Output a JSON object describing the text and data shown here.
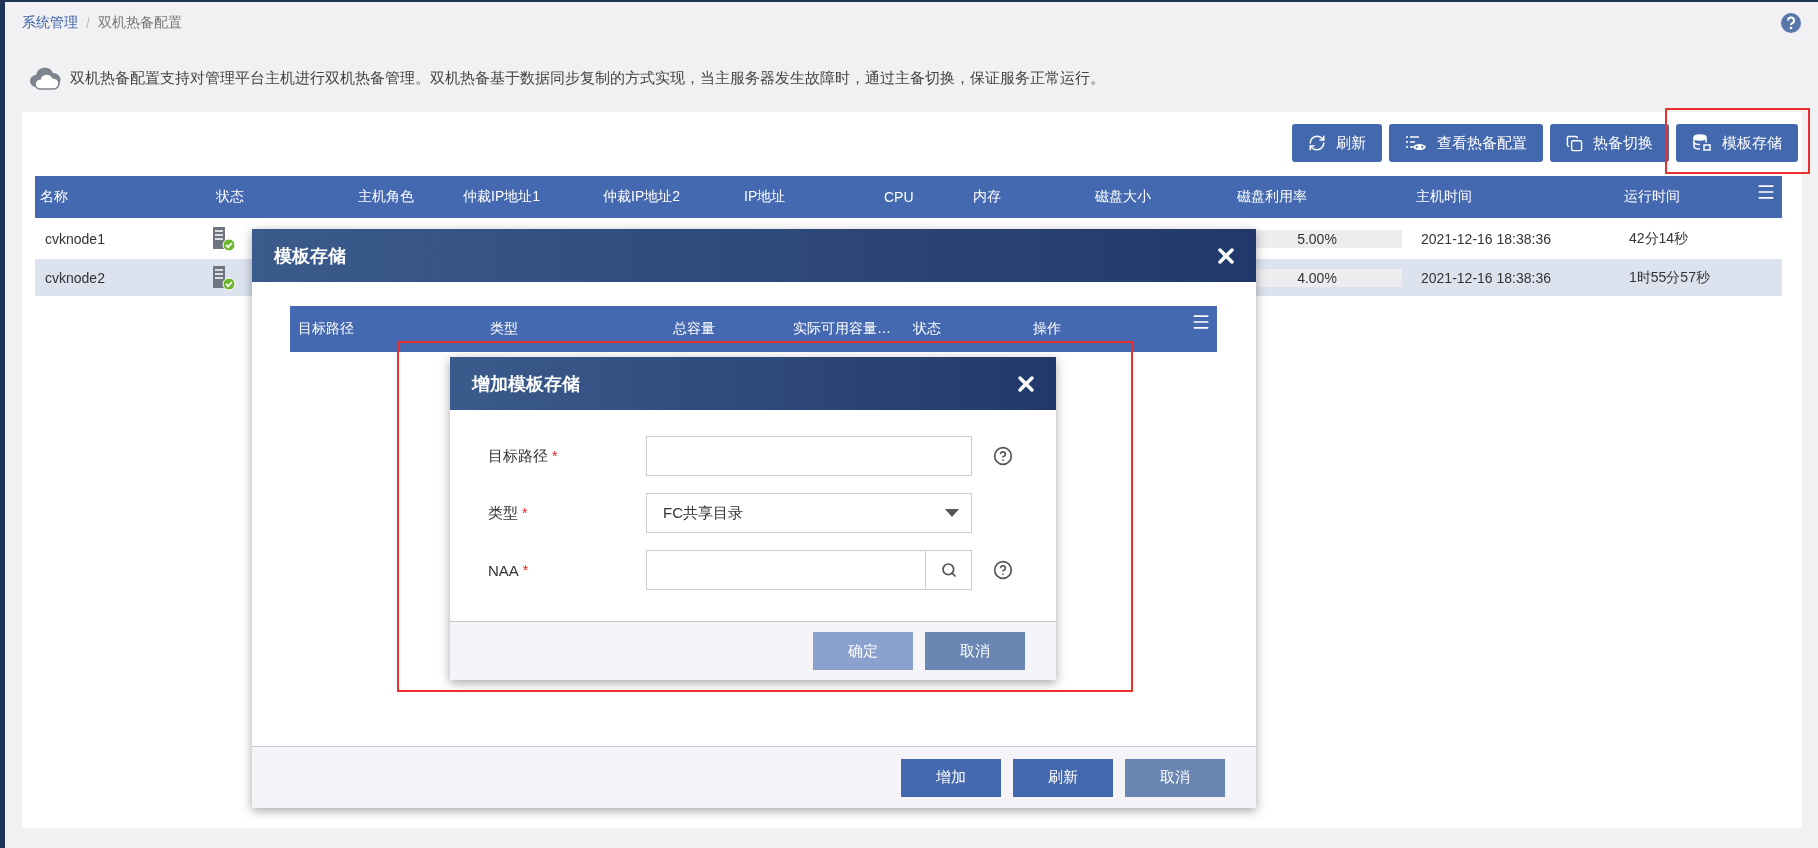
{
  "breadcrumb": {
    "parent": "系统管理",
    "separator": "/",
    "current": "双机热备配置"
  },
  "info_text": "双机热备配置支持对管理平台主机进行双机热备管理。双机热备基于数据同步复制的方式实现，当主服务器发生故障时，通过主备切换，保证服务正常运行。",
  "toolbar": [
    {
      "label": "刷新",
      "kind": "refresh"
    },
    {
      "label": "查看热备配置",
      "kind": "view"
    },
    {
      "label": "热备切换",
      "kind": "switch"
    },
    {
      "label": "模板存储",
      "kind": "storage"
    }
  ],
  "table": {
    "columns": [
      "名称",
      "状态",
      "主机角色",
      "仲裁IP地址1",
      "仲裁IP地址2",
      "IP地址",
      "CPU",
      "内存",
      "磁盘大小",
      "磁盘利用率",
      "主机时间",
      "运行时间"
    ],
    "rows": [
      {
        "name": "cvknode1",
        "selected": false,
        "disk_usage": "5.00%",
        "host_time": "2021-12-16 18:38:36",
        "run_time": "42分14秒"
      },
      {
        "name": "cvknode2",
        "selected": true,
        "disk_usage": "4.00%",
        "host_time": "2021-12-16 18:38:36",
        "run_time": "1时55分57秒"
      }
    ]
  },
  "dialog": {
    "title": "模板存储",
    "columns": [
      "目标路径",
      "类型",
      "总容量",
      "实际可用容量…",
      "状态",
      "操作"
    ],
    "buttons": [
      {
        "label": "增加",
        "kind": "primary",
        "disabled": false
      },
      {
        "label": "刷新",
        "kind": "primary",
        "disabled": false
      },
      {
        "label": "取消",
        "kind": "cancel",
        "disabled": false
      }
    ]
  },
  "subdialog": {
    "title": "增加模板存储",
    "fields": [
      {
        "label": "目标路径",
        "required_mark": "*",
        "kind": "text",
        "help": true
      },
      {
        "label": "类型",
        "required_mark": "*",
        "kind": "select",
        "value": "FC共享目录"
      },
      {
        "label": "NAA",
        "required_mark": "*",
        "kind": "search",
        "help": true
      }
    ],
    "buttons": [
      {
        "label": "确定",
        "kind": "primary",
        "disabled": true
      },
      {
        "label": "取消",
        "kind": "cancel",
        "disabled": false
      }
    ]
  }
}
